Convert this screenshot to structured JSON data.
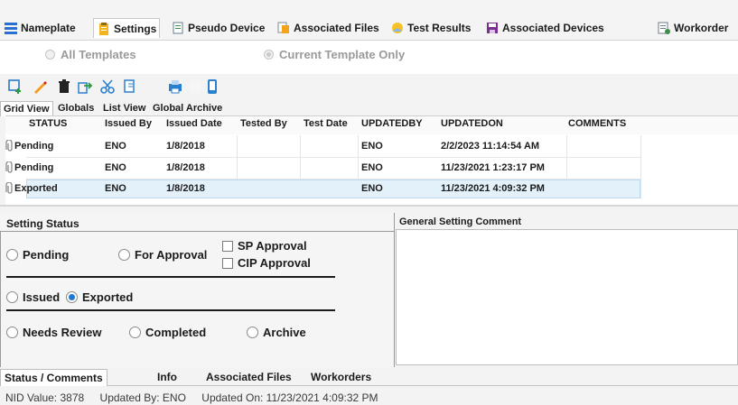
{
  "main_tabs": [
    {
      "label": "Nameplate",
      "icon": "nameplate-list-icon"
    },
    {
      "label": "Settings",
      "icon": "clipboard-icon"
    },
    {
      "label": "Pseudo Device",
      "icon": "pseudo-device-icon"
    },
    {
      "label": "Associated Files",
      "icon": "files-icon"
    },
    {
      "label": "Test Results",
      "icon": "test-results-icon"
    },
    {
      "label": "Associated Devices",
      "icon": "floppy-disk-icon"
    },
    {
      "label": "Workorder",
      "icon": "workorder-icon"
    }
  ],
  "template_filter": {
    "all": "All Templates",
    "current": "Current Template Only"
  },
  "toolbar_icons": [
    "add-icon",
    "edit-pencil-icon",
    "delete-trash-icon",
    "export-icon",
    "cut-scissors-icon",
    "copy-page-icon",
    "print-icon",
    "blank-icon",
    "mobile-device-icon"
  ],
  "sub_tabs": [
    "Grid View",
    "Globals",
    "List View",
    "Global Archive"
  ],
  "grid": {
    "columns": [
      "STATUS",
      "Issued By",
      "Issued Date",
      "Tested By",
      "Test Date",
      "UPDATEDBY",
      "UPDATEDON",
      "COMMENTS"
    ],
    "rows": [
      {
        "status": "Pending",
        "issued_by": "ENO",
        "issued_date": "1/8/2018",
        "tested_by": "",
        "test_date": "",
        "updatedby": "ENO",
        "updatedon": "2/2/2023 11:14:54 AM",
        "comments": ""
      },
      {
        "status": "Pending",
        "issued_by": "ENO",
        "issued_date": "1/8/2018",
        "tested_by": "",
        "test_date": "",
        "updatedby": "ENO",
        "updatedon": "11/23/2021 1:23:17 PM",
        "comments": ""
      },
      {
        "status": "Exported",
        "issued_by": "ENO",
        "issued_date": "1/8/2018",
        "tested_by": "",
        "test_date": "",
        "updatedby": "ENO",
        "updatedon": "11/23/2021 4:09:32 PM",
        "comments": ""
      }
    ]
  },
  "setting_status": {
    "title": "Setting Status",
    "pending": "Pending",
    "for_approval": "For Approval",
    "sp_approval": "SP Approval",
    "cip_approval": "CIP Approval",
    "issued": "Issued",
    "exported": "Exported",
    "needs_review": "Needs Review",
    "completed": "Completed",
    "archive": "Archive",
    "selected": "Exported"
  },
  "comment_panel": {
    "title": "General Setting Comment",
    "value": ""
  },
  "bottom_tabs": [
    "Status / Comments",
    "Info",
    "Associated Files",
    "Workorders"
  ],
  "footer": {
    "nid_label": "NID Value:",
    "nid_value": "3878",
    "updated_by_label": "Updated By:",
    "updated_by_value": "ENO",
    "updated_on_label": "Updated On:",
    "updated_on_value": "11/23/2021 4:09:32 PM"
  }
}
